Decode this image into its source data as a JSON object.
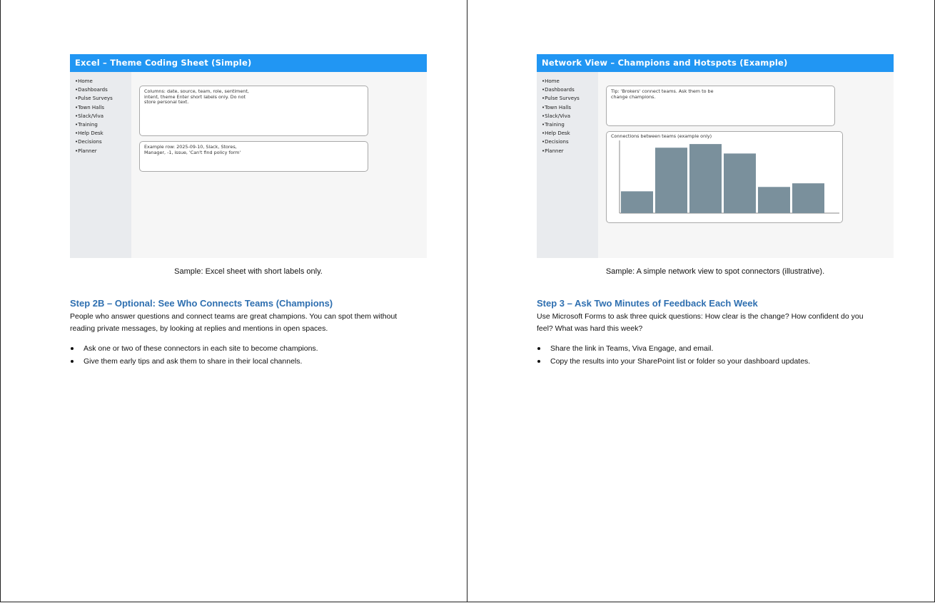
{
  "left": {
    "figure": {
      "title": "Excel – Theme Coding Sheet (Simple)",
      "sidebar": [
        "Home",
        "Dashboards",
        "Pulse Surveys",
        "Town Halls",
        "Slack/Viva",
        "Training",
        "Help Desk",
        "Decisions",
        "Planner"
      ],
      "card1": "Columns: date, source, team, role, sentiment, intent, theme Enter short labels only. Do not store personal text.",
      "card2": "Example row: 2025-09-10, Slack, Stores, Manager, -1, issue, 'Can't find policy form'"
    },
    "caption": "Sample: Excel sheet with short labels only.",
    "heading": "Step 2B – Optional: See Who Connects Teams (Champions)",
    "paragraph": "People who answer questions and connect teams are great champions. You can spot them without reading private messages, by looking at replies and mentions in open spaces.",
    "bullets": [
      "Ask one or two of these connectors in each site to become champions.",
      "Give them early tips and ask them to share in their local channels."
    ]
  },
  "right": {
    "figure": {
      "title": "Network View – Champions and Hotspots (Example)",
      "sidebar": [
        "Home",
        "Dashboards",
        "Pulse Surveys",
        "Town Halls",
        "Slack/Viva",
        "Training",
        "Help Desk",
        "Decisions",
        "Planner"
      ],
      "card1": "Tip: 'Brokers' connect teams. Ask them to be change champions."
    },
    "caption": "Sample: A simple network view to spot connectors (illustrative).",
    "heading": "Step 3 – Ask Two Minutes of Feedback Each Week",
    "paragraph": "Use Microsoft Forms to ask three quick questions: How clear is the change? How confident do you feel? What was hard this week?",
    "bullets": [
      "Share the link in Teams, Viva Engage, and email.",
      "Copy the results into your SharePoint list or folder so your dashboard updates."
    ]
  },
  "chart_data": {
    "type": "bar",
    "title": "Connections between teams (example only)",
    "categories": [
      "",
      "",
      "",
      "",
      "",
      ""
    ],
    "values": [
      3,
      9,
      9.5,
      8.2,
      3.6,
      4.1
    ],
    "ylim": [
      0,
      10
    ],
    "bar_color": "#7a909c",
    "xlabel": "",
    "ylabel": ""
  },
  "colors": {
    "header": "#2196f3",
    "heading": "#2e6fb0",
    "sidebar": "#e9ebee",
    "panel": "#f6f6f6"
  }
}
